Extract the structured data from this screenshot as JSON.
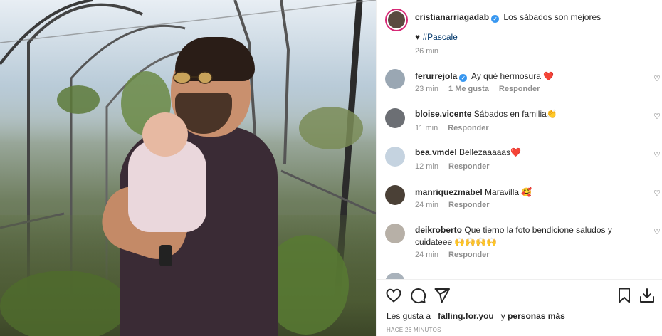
{
  "post": {
    "author": "cristianarriagadab",
    "caption": "Los sábados son mejores",
    "caption_line2_prefix": "♥",
    "hashtag": "#Pascale",
    "time": "26 min"
  },
  "comments": [
    {
      "user": "ferurrejola",
      "verified": true,
      "text": "Ay qué hermosura ❤️",
      "time": "23 min",
      "likes": "1 Me gusta",
      "reply": "Responder"
    },
    {
      "user": "bloise.vicente",
      "verified": false,
      "text": "Sábados en familia👏",
      "time": "11 min",
      "likes": "",
      "reply": "Responder"
    },
    {
      "user": "bea.vmdel",
      "verified": false,
      "text": "Bellezaaaaas❤️",
      "time": "12 min",
      "likes": "",
      "reply": "Responder"
    },
    {
      "user": "manriquezmabel",
      "verified": false,
      "text": "Maravilla 🥰",
      "time": "24 min",
      "likes": "",
      "reply": "Responder"
    },
    {
      "user": "deikroberto",
      "verified": false,
      "text": "Que tierno la foto bendicione saludos y cuidateee 🙌🙌🙌🙌",
      "time": "24 min",
      "likes": "",
      "reply": "Responder"
    }
  ],
  "likes": {
    "prefix": "Les gusta a",
    "user": "_falling.for.you_",
    "middle": "y",
    "others": "personas más"
  },
  "timestamp": "HACE 26 MINUTOS",
  "icons": [
    "heart-icon",
    "comment-icon",
    "share-icon",
    "save-icon",
    "download-icon"
  ]
}
